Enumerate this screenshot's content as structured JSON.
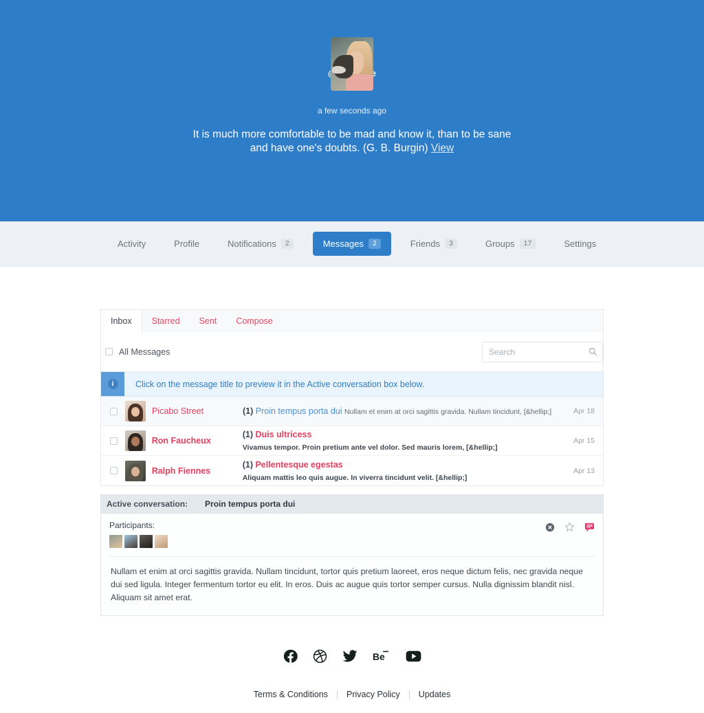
{
  "hero": {
    "handle": "@michellie",
    "time": "a few seconds ago",
    "quote": "It is much more comfortable to be mad and know it, than to be sane and have one's doubts. (G. B. Burgin)",
    "quote_link": "View",
    "background_color": "#2e7dc9",
    "avatar_name": "michellie-avatar"
  },
  "nav": {
    "items": [
      {
        "label": "Activity",
        "badge": "",
        "active": false
      },
      {
        "label": "Profile",
        "badge": "",
        "active": false
      },
      {
        "label": "Notifications",
        "badge": "2",
        "active": false
      },
      {
        "label": "Messages",
        "badge": "2",
        "active": true
      },
      {
        "label": "Friends",
        "badge": "3",
        "active": false
      },
      {
        "label": "Groups",
        "badge": "17",
        "active": false
      },
      {
        "label": "Settings",
        "badge": "",
        "active": false
      }
    ],
    "active_color": "#2e7dc9",
    "bar_color": "#edf1f5"
  },
  "subtabs": [
    {
      "label": "Inbox",
      "active": true
    },
    {
      "label": "Starred",
      "active": false
    },
    {
      "label": "Sent",
      "active": false
    },
    {
      "label": "Compose",
      "active": false
    }
  ],
  "filter": {
    "all_messages_label": "All Messages",
    "checkbox_checked": false
  },
  "search": {
    "placeholder": "Search",
    "value": "",
    "icon": "search-icon"
  },
  "notice": {
    "icon_glyph": "i",
    "text": "Click on the message title to preview it in the Active conversation box below.",
    "text_color": "#2f7cc4",
    "background": "#eaf4fd"
  },
  "messages": [
    {
      "sender": "Picabo Street",
      "count": "(1)",
      "subject": "Proin tempus porta dui",
      "excerpt": "Nullam et enim at orci sagittis gravida. Nullam tincidunt, [&hellip;]",
      "date": "Apr 18",
      "unread": false
    },
    {
      "sender": "Ron Faucheux",
      "count": "(1)",
      "subject": "Duis ultricess",
      "excerpt": "Vivamus tempor. Proin pretium ante vel dolor. Sed mauris lorem, [&hellip;]",
      "date": "Apr 15",
      "unread": true
    },
    {
      "sender": "Ralph Fiennes",
      "count": "(1)",
      "subject": "Pellentesque egestas",
      "excerpt": "Aliquam mattis leo quis augue. In viverra tincidunt velit. [&hellip;]",
      "date": "Apr 13",
      "unread": true
    }
  ],
  "conversation": {
    "header_label": "Active conversation:",
    "header_value": "Proin tempus porta dui",
    "participants_label": "Participants:",
    "participant_count": 4,
    "actions": [
      {
        "name": "delete-icon",
        "color": "#5c656e"
      },
      {
        "name": "star-icon",
        "color": "#aeb6bd"
      },
      {
        "name": "reply-icon",
        "color": "#e3336b"
      }
    ],
    "body": "Nullam et enim at orci sagittis gravida. Nullam tincidunt, tortor quis pretium laoreet, eros neque dictum felis, nec gravida neque dui sed ligula. Integer fermentum tortor eu elit. In eros. Duis ac augue quis tortor semper cursus. Nulla dignissim blandit nisl. Aliquam sit amet erat."
  },
  "footer": {
    "socials": [
      "facebook-icon",
      "dribbble-icon",
      "twitter-icon",
      "behance-icon",
      "youtube-icon"
    ],
    "links": [
      "Terms & Conditions",
      "Privacy Policy",
      "Updates"
    ]
  }
}
